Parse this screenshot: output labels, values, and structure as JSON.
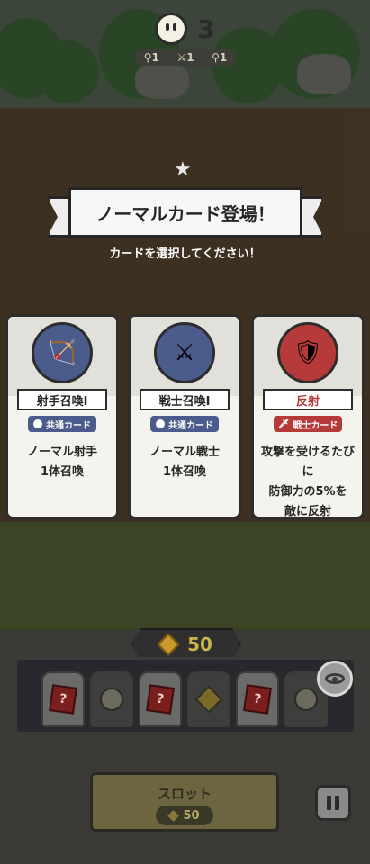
{
  "top": {
    "lives": "3",
    "stats": [
      "1",
      "1",
      "1"
    ]
  },
  "banner": {
    "title": "ノーマルカード登場！",
    "subtitle": "カードを選択してください！"
  },
  "cards": [
    {
      "name": "射手召喚Ⅰ",
      "tag": "共通カード",
      "desc_line1": "ノーマル射手",
      "desc_line2": "1体召喚",
      "desc_line3": "",
      "icon": "archer-icon"
    },
    {
      "name": "戦士召喚Ⅰ",
      "tag": "共通カード",
      "desc_line1": "ノーマル戦士",
      "desc_line2": "1体召喚",
      "desc_line3": "",
      "icon": "warrior-icon"
    },
    {
      "name": "反射",
      "tag": "戦士カード",
      "desc_line1": "攻撃を受けるたびに",
      "desc_line2": "防御力の5%を",
      "desc_line3": "敵に反射",
      "icon": "reflect-icon"
    }
  ],
  "coins": {
    "value": "50"
  },
  "slot_machine": {
    "slots": [
      "question-card-icon",
      "face-icon",
      "question-card-icon",
      "diamond-icon",
      "question-card-icon",
      "face-icon"
    ],
    "button_label": "スロット",
    "cost": "50"
  },
  "colors": {
    "common": "#4b5b8c",
    "warrior": "#b63a3a",
    "gold": "#c9b44a"
  }
}
